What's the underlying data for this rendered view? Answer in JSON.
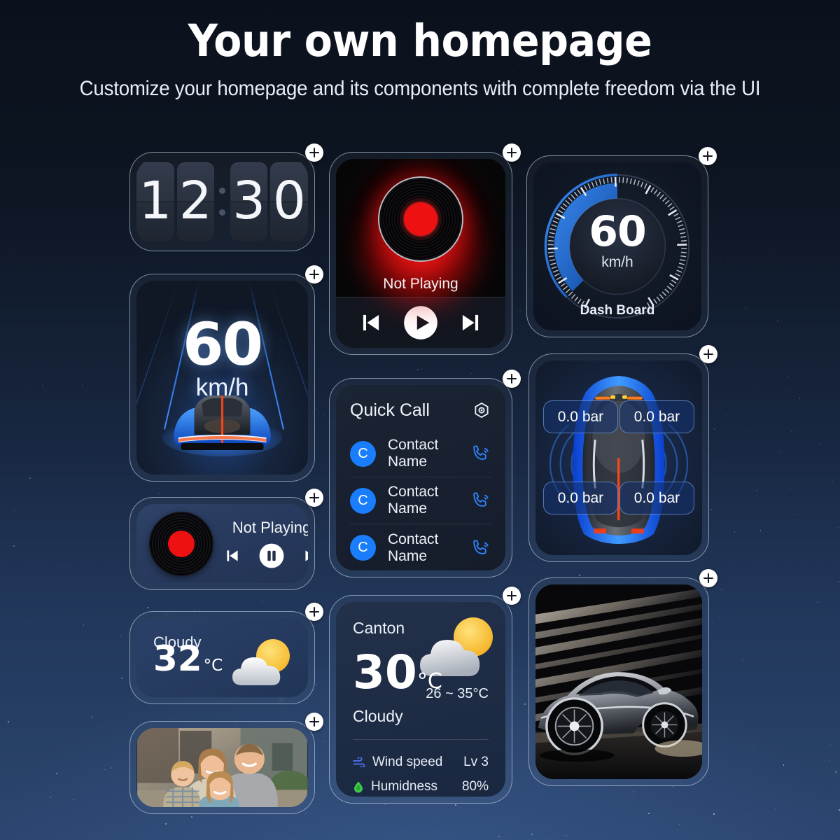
{
  "header": {
    "title": "Your own homepage",
    "subtitle": "Customize your homepage and its components with complete freedom via the UI"
  },
  "add_button_label": "+",
  "colors": {
    "accent_blue": "#1a7dfb",
    "gauge_arc": "#1a6fd4",
    "vinyl_red": "#ee1111",
    "humidity_green": "#3ecf4a",
    "wind_blue": "#4a6ee0",
    "card_border": "#c4d4ea"
  },
  "widgets": {
    "clock": {
      "name": "Flip Clock",
      "digits": [
        "1",
        "2",
        "3",
        "0"
      ],
      "time": "12:30"
    },
    "hud": {
      "name": "Head Up Display",
      "speed": "60",
      "unit": "km/h"
    },
    "music_big": {
      "name": "Music Player",
      "status": "Not Playing",
      "controls": [
        "previous-track",
        "play",
        "next-track"
      ]
    },
    "gauge": {
      "name": "Dash Board Gauge",
      "speed": "60",
      "unit": "km/h",
      "label": "Dash Board"
    },
    "quick_call": {
      "title": "Quick Call",
      "settings_icon": "hexagon-gear-icon",
      "contacts": [
        {
          "initial": "C",
          "name": "Contact Name"
        },
        {
          "initial": "C",
          "name": "Contact Name"
        },
        {
          "initial": "C",
          "name": "Contact Name"
        }
      ]
    },
    "tire": {
      "name": "Tire Pressure Monitor",
      "front_left": "0.0 bar",
      "front_right": "0.0 bar",
      "rear_left": "0.0 bar",
      "rear_right": "0.0 bar"
    },
    "music_small": {
      "name": "Mini Music Player",
      "status": "Not Playing",
      "controls": [
        "previous-track",
        "pause",
        "next-track"
      ]
    },
    "weather_small": {
      "condition": "Cloudy",
      "temperature": "32",
      "unit": "°C",
      "icon": "sun-behind-cloud-icon"
    },
    "weather_big": {
      "city": "Canton",
      "temperature": "30",
      "unit": "°C",
      "range": "26 ~ 35°C",
      "condition": "Cloudy",
      "icon": "sun-behind-cloud-icon",
      "details": [
        {
          "icon": "wind-icon",
          "label": "Wind speed",
          "value": "Lv 3"
        },
        {
          "icon": "humidity-icon",
          "label": "Humidness",
          "value": "80%"
        }
      ]
    },
    "photo": {
      "name": "Family Photo",
      "alt": "family-photo"
    },
    "car_photo": {
      "name": "Sports Car Photo",
      "alt": "silver-sports-car-light-streaks"
    }
  }
}
